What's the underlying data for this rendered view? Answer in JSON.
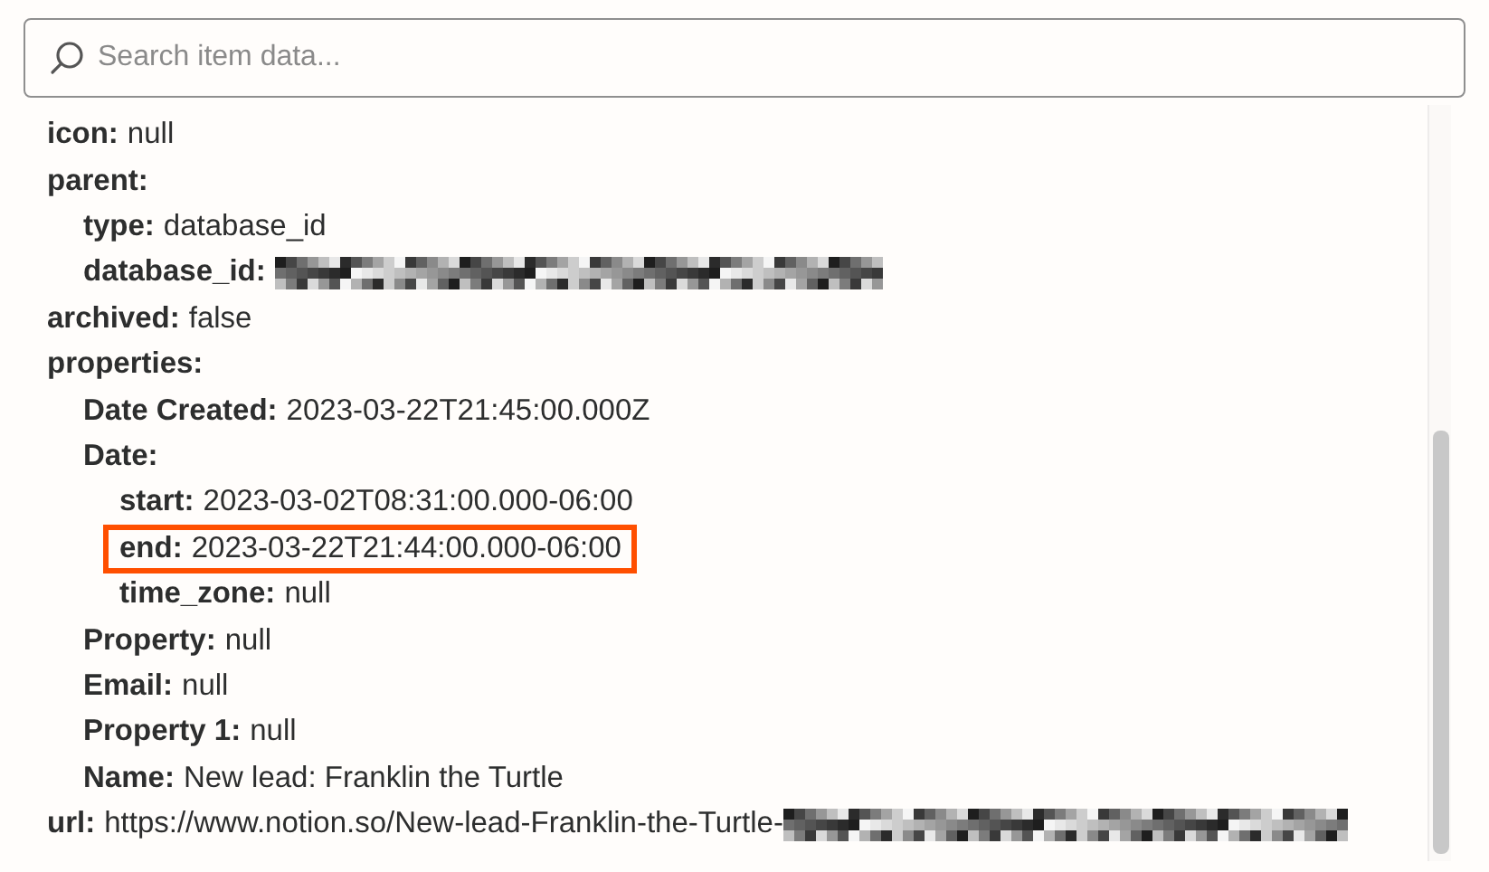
{
  "search": {
    "placeholder": "Search item data..."
  },
  "items": [
    {
      "key": "icon:",
      "value": "null",
      "highlighted": false,
      "redacted": false
    },
    {
      "key": "parent:",
      "highlighted": false,
      "redacted": false,
      "children": [
        {
          "key": "type:",
          "value": "database_id",
          "highlighted": false,
          "redacted": false
        },
        {
          "key": "database_id:",
          "highlighted": false,
          "redacted": true
        }
      ]
    },
    {
      "key": "archived:",
      "value": "false",
      "highlighted": false,
      "redacted": false
    },
    {
      "key": "properties:",
      "highlighted": false,
      "redacted": false,
      "children": [
        {
          "key": "Date Created:",
          "value": "2023-03-22T21:45:00.000Z",
          "highlighted": false,
          "redacted": false
        },
        {
          "key": "Date:",
          "highlighted": false,
          "redacted": false,
          "children": [
            {
              "key": "start:",
              "value": "2023-03-02T08:31:00.000-06:00",
              "highlighted": false,
              "redacted": false
            },
            {
              "key": "end:",
              "value": "2023-03-22T21:44:00.000-06:00",
              "highlighted": true,
              "redacted": false
            },
            {
              "key": "time_zone:",
              "value": "null",
              "highlighted": false,
              "redacted": false
            }
          ]
        },
        {
          "key": "Property:",
          "value": "null",
          "highlighted": false,
          "redacted": false
        },
        {
          "key": "Email:",
          "value": "null",
          "highlighted": false,
          "redacted": false
        },
        {
          "key": "Property 1:",
          "value": "null",
          "highlighted": false,
          "redacted": false
        },
        {
          "key": "Name:",
          "value": "New lead: Franklin the Turtle",
          "highlighted": false,
          "redacted": false
        }
      ]
    },
    {
      "key": "url:",
      "value": "https://www.notion.so/New-lead-Franklin-the-Turtle-",
      "highlighted": false,
      "redacted": true
    }
  ]
}
